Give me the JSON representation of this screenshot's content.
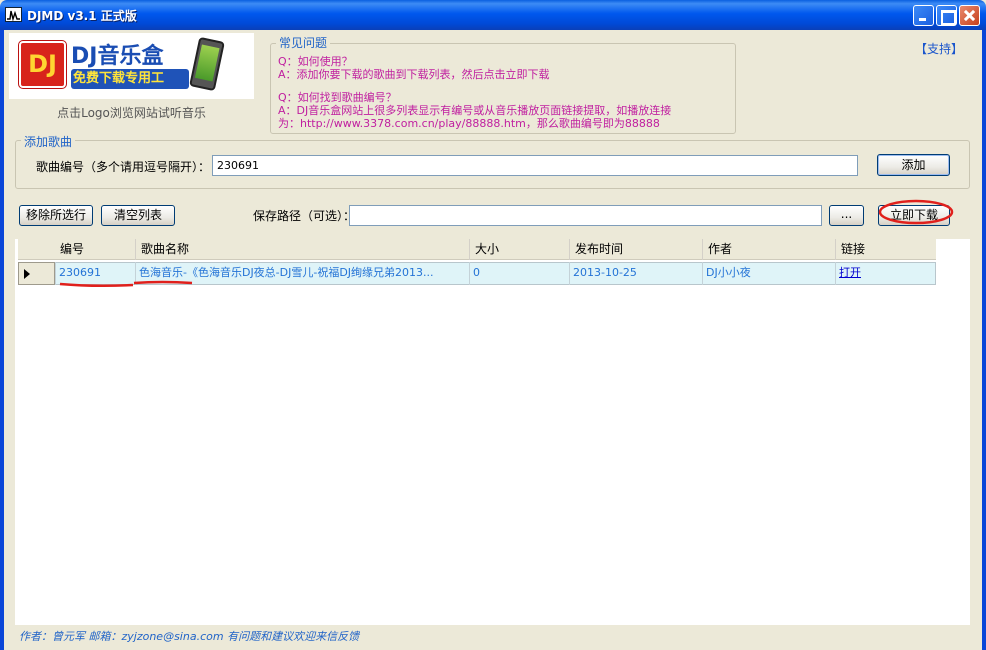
{
  "window": {
    "title": "DJMD  v3.1  正式版",
    "accent": "#0055e5"
  },
  "logo": {
    "badge": "DJ",
    "brand": "DJ音乐盒",
    "tagline": "免费下载专用工",
    "caption": "点击Logo浏览网站试听音乐"
  },
  "faq": {
    "title": "常见问题",
    "lines": [
      "Q：如何使用？",
      "A：添加你要下载的歌曲到下载列表，然后点击立即下载",
      "Q：如何找到歌曲编号？",
      "A：DJ音乐盒网站上很多列表显示有编号或从音乐播放页面链接提取，如播放连接",
      "为：http://www.3378.com.cn/play/88888.htm，那么歌曲编号即为88888"
    ]
  },
  "support_link": "【支持】",
  "add_songs": {
    "group_title": "添加歌曲",
    "label": "歌曲编号（多个请用逗号隔开）：",
    "value": "230691",
    "add_button": "添加"
  },
  "toolbar": {
    "remove_selected": "移除所选行",
    "clear_list": "清空列表",
    "save_path_label": "保存路径（可选）：",
    "save_path_value": "",
    "browse_button": "...",
    "download_now": "立即下载"
  },
  "grid": {
    "columns": [
      "编号",
      "歌曲名称",
      "大小",
      "发布时间",
      "作者",
      "链接"
    ],
    "rows": [
      {
        "id": "230691",
        "name": "色海音乐-《色海音乐DJ夜总-DJ雪儿-祝福DJ绚缘兄弟2013...",
        "size": "0",
        "date": "2013-10-25",
        "author": "DJ小小夜",
        "link": "打开"
      }
    ]
  },
  "footer": "作者：曾元军   邮箱：zyjzone@sina.com  有问题和建议欢迎来信反馈",
  "annotation_color": "#e0201c"
}
